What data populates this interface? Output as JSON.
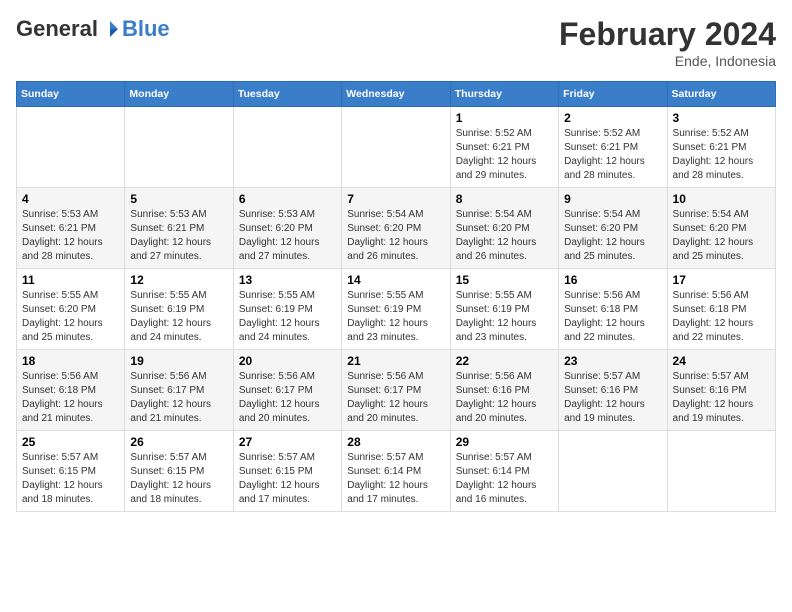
{
  "logo": {
    "general": "General",
    "blue": "Blue"
  },
  "header": {
    "title": "February 2024",
    "location": "Ende, Indonesia"
  },
  "weekdays": [
    "Sunday",
    "Monday",
    "Tuesday",
    "Wednesday",
    "Thursday",
    "Friday",
    "Saturday"
  ],
  "weeks": [
    [
      {
        "day": "",
        "info": ""
      },
      {
        "day": "",
        "info": ""
      },
      {
        "day": "",
        "info": ""
      },
      {
        "day": "",
        "info": ""
      },
      {
        "day": "1",
        "info": "Sunrise: 5:52 AM\nSunset: 6:21 PM\nDaylight: 12 hours and 29 minutes."
      },
      {
        "day": "2",
        "info": "Sunrise: 5:52 AM\nSunset: 6:21 PM\nDaylight: 12 hours and 28 minutes."
      },
      {
        "day": "3",
        "info": "Sunrise: 5:52 AM\nSunset: 6:21 PM\nDaylight: 12 hours and 28 minutes."
      }
    ],
    [
      {
        "day": "4",
        "info": "Sunrise: 5:53 AM\nSunset: 6:21 PM\nDaylight: 12 hours and 28 minutes."
      },
      {
        "day": "5",
        "info": "Sunrise: 5:53 AM\nSunset: 6:21 PM\nDaylight: 12 hours and 27 minutes."
      },
      {
        "day": "6",
        "info": "Sunrise: 5:53 AM\nSunset: 6:20 PM\nDaylight: 12 hours and 27 minutes."
      },
      {
        "day": "7",
        "info": "Sunrise: 5:54 AM\nSunset: 6:20 PM\nDaylight: 12 hours and 26 minutes."
      },
      {
        "day": "8",
        "info": "Sunrise: 5:54 AM\nSunset: 6:20 PM\nDaylight: 12 hours and 26 minutes."
      },
      {
        "day": "9",
        "info": "Sunrise: 5:54 AM\nSunset: 6:20 PM\nDaylight: 12 hours and 25 minutes."
      },
      {
        "day": "10",
        "info": "Sunrise: 5:54 AM\nSunset: 6:20 PM\nDaylight: 12 hours and 25 minutes."
      }
    ],
    [
      {
        "day": "11",
        "info": "Sunrise: 5:55 AM\nSunset: 6:20 PM\nDaylight: 12 hours and 25 minutes."
      },
      {
        "day": "12",
        "info": "Sunrise: 5:55 AM\nSunset: 6:19 PM\nDaylight: 12 hours and 24 minutes."
      },
      {
        "day": "13",
        "info": "Sunrise: 5:55 AM\nSunset: 6:19 PM\nDaylight: 12 hours and 24 minutes."
      },
      {
        "day": "14",
        "info": "Sunrise: 5:55 AM\nSunset: 6:19 PM\nDaylight: 12 hours and 23 minutes."
      },
      {
        "day": "15",
        "info": "Sunrise: 5:55 AM\nSunset: 6:19 PM\nDaylight: 12 hours and 23 minutes."
      },
      {
        "day": "16",
        "info": "Sunrise: 5:56 AM\nSunset: 6:18 PM\nDaylight: 12 hours and 22 minutes."
      },
      {
        "day": "17",
        "info": "Sunrise: 5:56 AM\nSunset: 6:18 PM\nDaylight: 12 hours and 22 minutes."
      }
    ],
    [
      {
        "day": "18",
        "info": "Sunrise: 5:56 AM\nSunset: 6:18 PM\nDaylight: 12 hours and 21 minutes."
      },
      {
        "day": "19",
        "info": "Sunrise: 5:56 AM\nSunset: 6:17 PM\nDaylight: 12 hours and 21 minutes."
      },
      {
        "day": "20",
        "info": "Sunrise: 5:56 AM\nSunset: 6:17 PM\nDaylight: 12 hours and 20 minutes."
      },
      {
        "day": "21",
        "info": "Sunrise: 5:56 AM\nSunset: 6:17 PM\nDaylight: 12 hours and 20 minutes."
      },
      {
        "day": "22",
        "info": "Sunrise: 5:56 AM\nSunset: 6:16 PM\nDaylight: 12 hours and 20 minutes."
      },
      {
        "day": "23",
        "info": "Sunrise: 5:57 AM\nSunset: 6:16 PM\nDaylight: 12 hours and 19 minutes."
      },
      {
        "day": "24",
        "info": "Sunrise: 5:57 AM\nSunset: 6:16 PM\nDaylight: 12 hours and 19 minutes."
      }
    ],
    [
      {
        "day": "25",
        "info": "Sunrise: 5:57 AM\nSunset: 6:15 PM\nDaylight: 12 hours and 18 minutes."
      },
      {
        "day": "26",
        "info": "Sunrise: 5:57 AM\nSunset: 6:15 PM\nDaylight: 12 hours and 18 minutes."
      },
      {
        "day": "27",
        "info": "Sunrise: 5:57 AM\nSunset: 6:15 PM\nDaylight: 12 hours and 17 minutes."
      },
      {
        "day": "28",
        "info": "Sunrise: 5:57 AM\nSunset: 6:14 PM\nDaylight: 12 hours and 17 minutes."
      },
      {
        "day": "29",
        "info": "Sunrise: 5:57 AM\nSunset: 6:14 PM\nDaylight: 12 hours and 16 minutes."
      },
      {
        "day": "",
        "info": ""
      },
      {
        "day": "",
        "info": ""
      }
    ]
  ]
}
